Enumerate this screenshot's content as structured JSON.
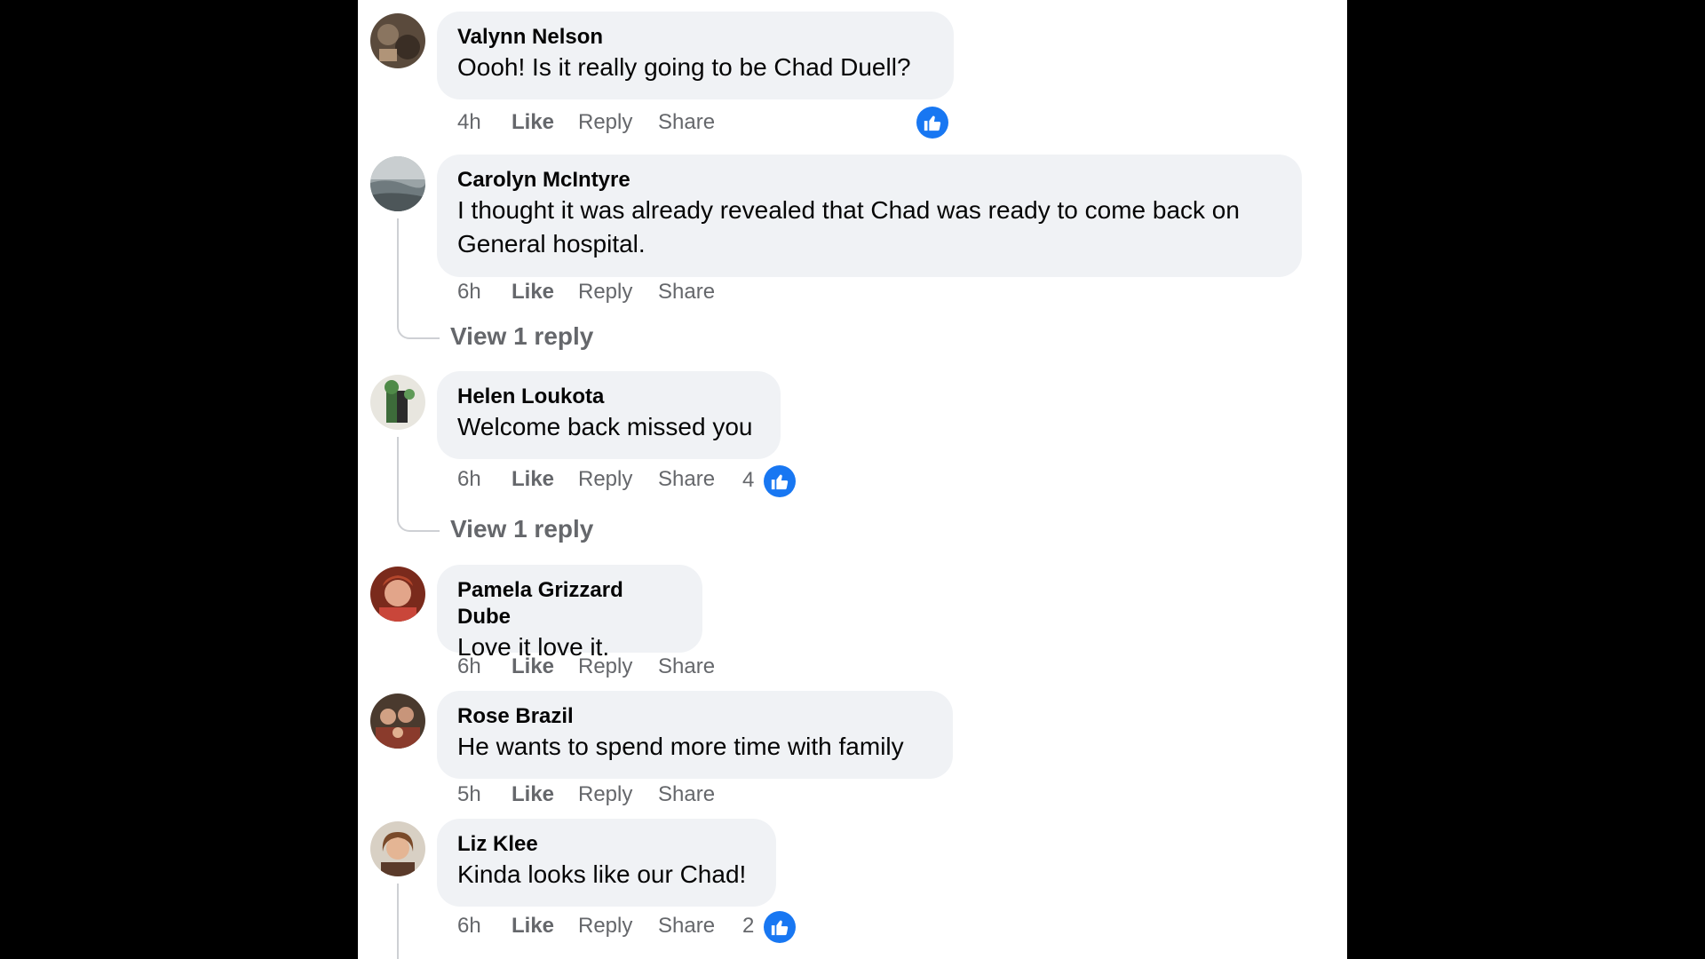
{
  "actions": {
    "like": "Like",
    "reply": "Reply",
    "share": "Share"
  },
  "accent_color": "#1877f2",
  "comments": [
    {
      "author": "Valynn Nelson",
      "text": "Oooh! Is it really going to be Chad Duell?",
      "time": "4h",
      "reaction_count": null,
      "reaction_icon": "thumbs-up-icon",
      "view_replies": null
    },
    {
      "author": "Carolyn McIntyre",
      "text": "I thought it was already revealed that Chad was ready to come back on General hospital.",
      "time": "6h",
      "reaction_count": null,
      "view_replies": "View 1 reply"
    },
    {
      "author": "Helen Loukota",
      "text": "Welcome back missed you",
      "time": "6h",
      "reaction_count": "4",
      "reaction_icon": "thumbs-up-icon",
      "view_replies": "View 1 reply"
    },
    {
      "author": "Pamela Grizzard Dube",
      "text": "Love it love it.",
      "time": "6h",
      "reaction_count": null,
      "view_replies": null
    },
    {
      "author": "Rose Brazil",
      "text": "He wants to spend more time with family",
      "time": "5h",
      "reaction_count": null,
      "view_replies": null
    },
    {
      "author": "Liz Klee",
      "text": "Kinda looks like our Chad!",
      "time": "6h",
      "reaction_count": "2",
      "reaction_icon": "thumbs-up-icon",
      "view_replies": null
    }
  ]
}
